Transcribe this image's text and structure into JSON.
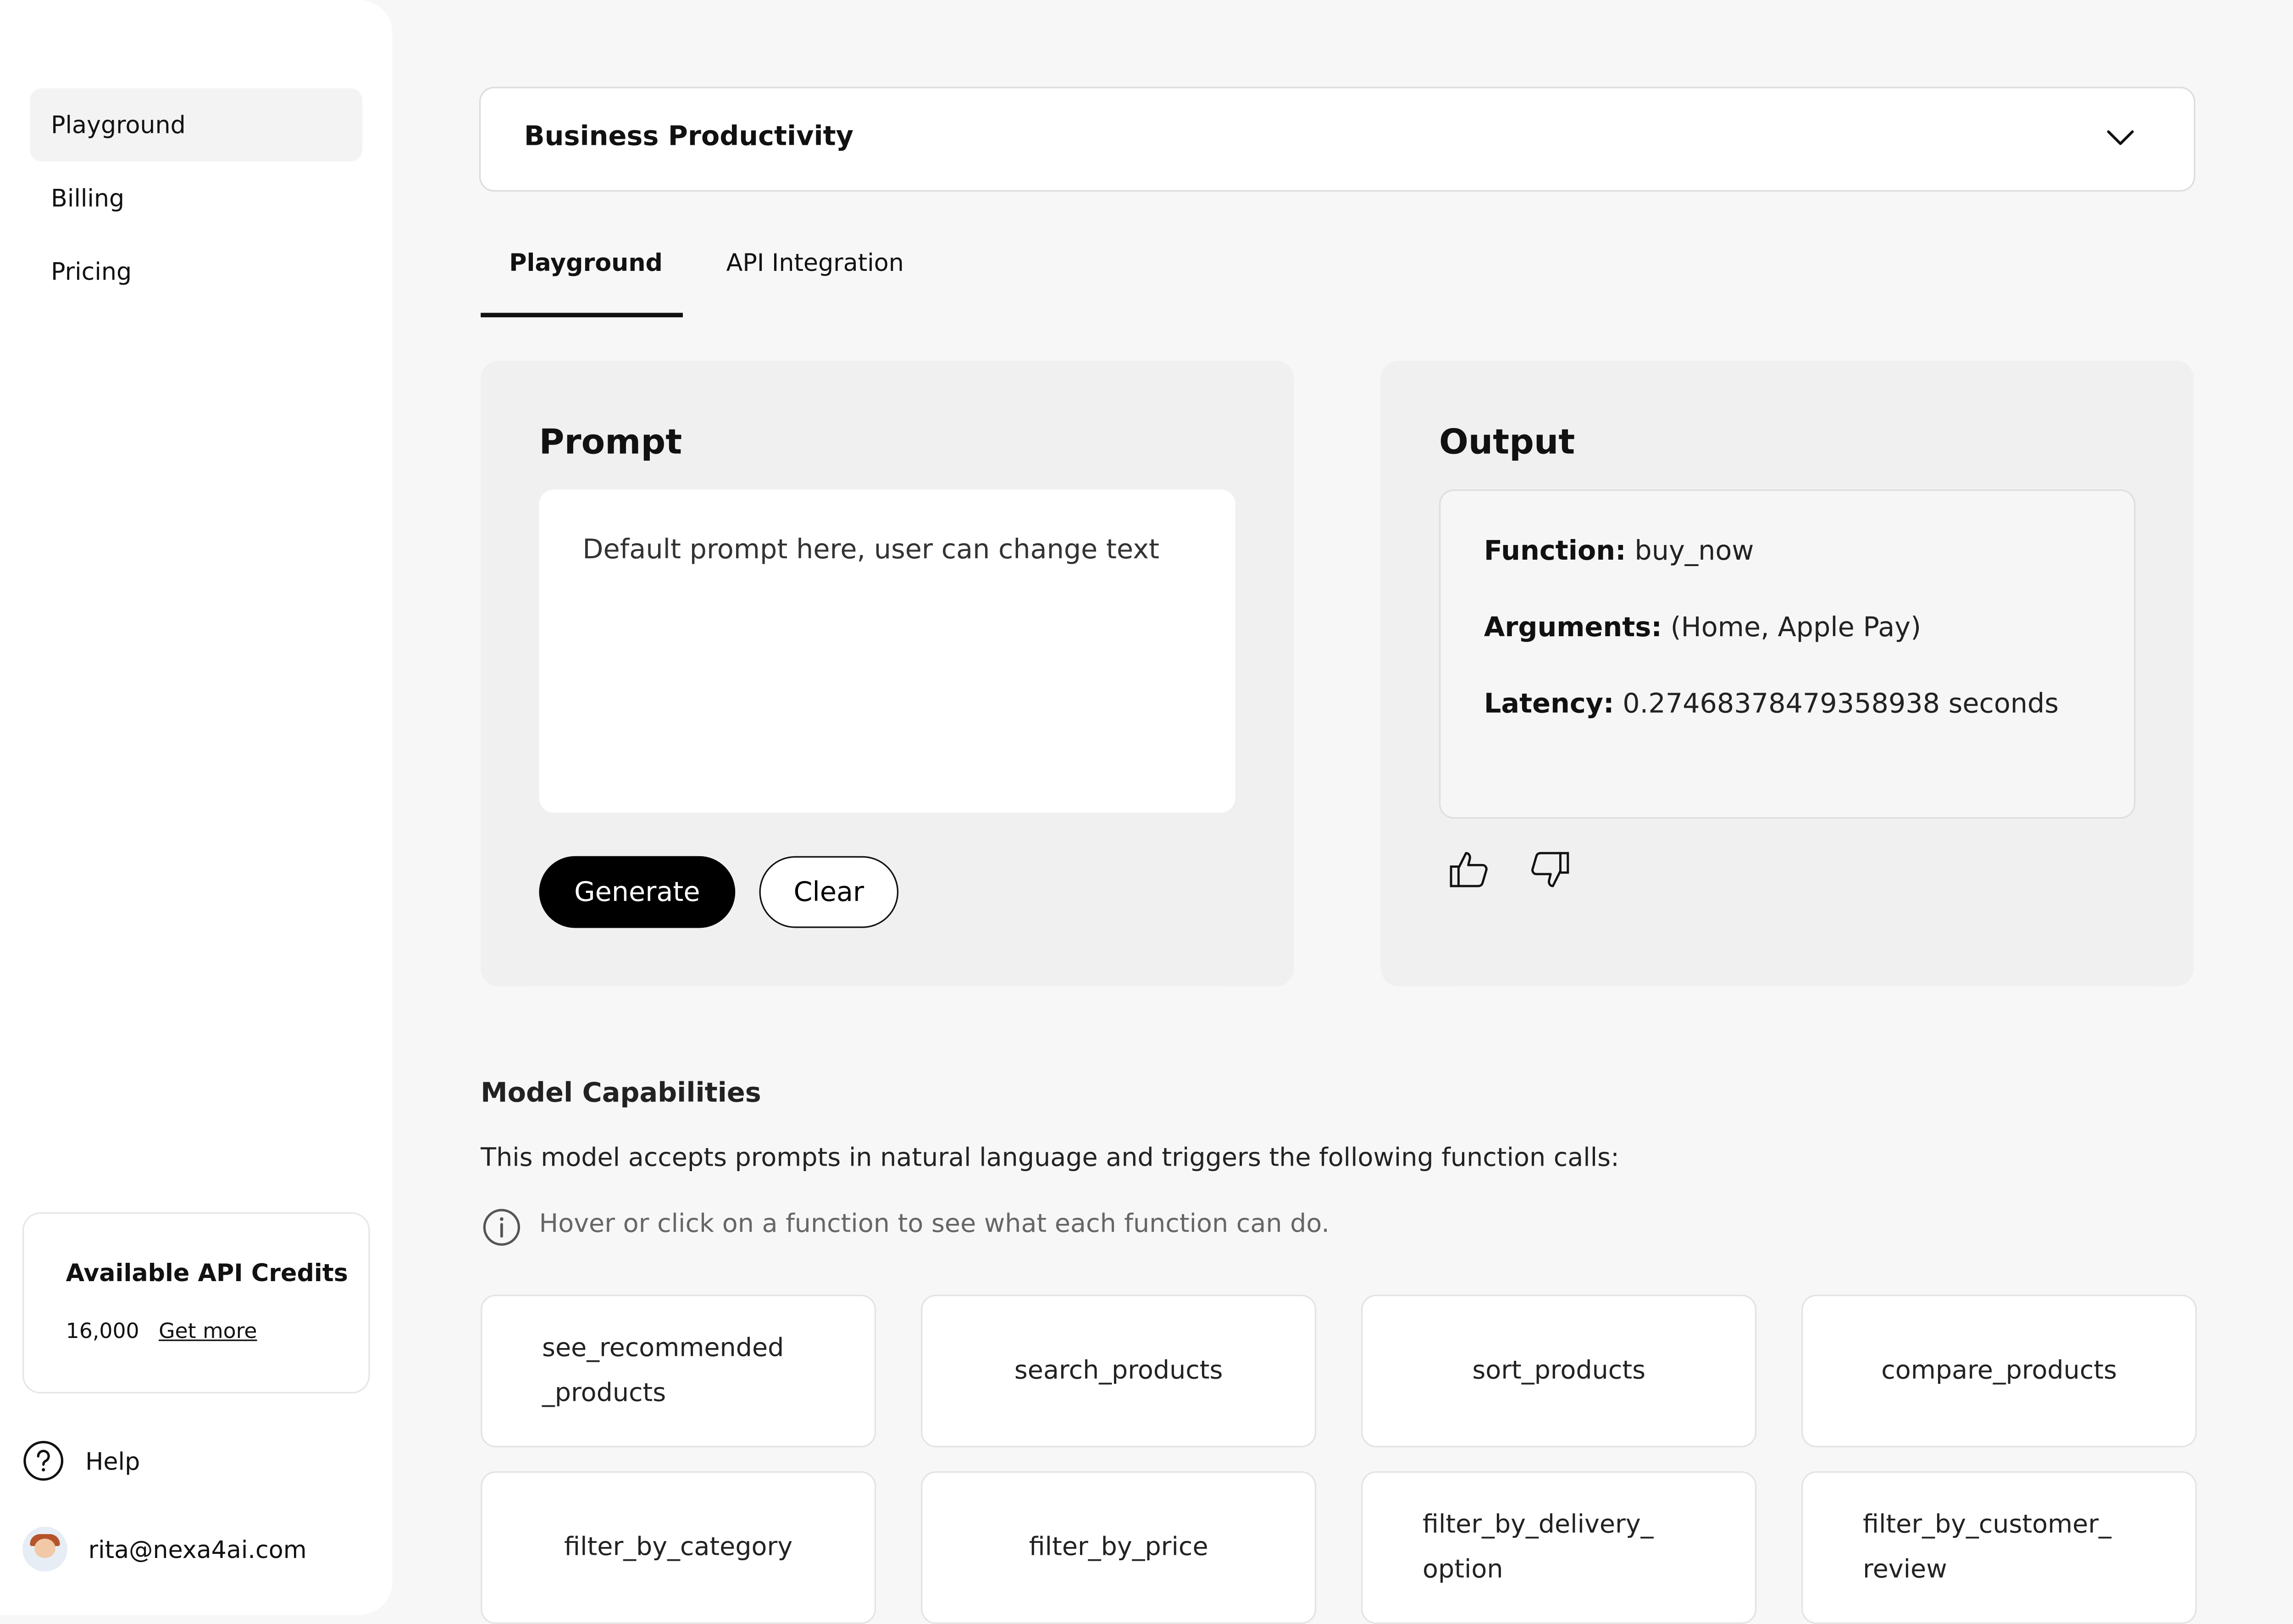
{
  "sidebar": {
    "items": [
      {
        "label": "Playground",
        "active": true
      },
      {
        "label": "Billing",
        "active": false
      },
      {
        "label": "Pricing",
        "active": false
      }
    ],
    "credits": {
      "title": "Available API Credits",
      "amount": "16,000",
      "link": "Get more"
    },
    "help": {
      "label": "Help",
      "icon": "question-circle-icon"
    },
    "user": {
      "email": "rita@nexa4ai.com"
    }
  },
  "dropdown": {
    "value": "Business Productivity",
    "icon": "chevron-down-icon"
  },
  "tabs": [
    {
      "label": "Playground",
      "active": true
    },
    {
      "label": "API Integration",
      "active": false
    }
  ],
  "prompt": {
    "title": "Prompt",
    "text": "Default prompt here, user can change text",
    "generate_label": "Generate",
    "clear_label": "Clear"
  },
  "output": {
    "title": "Output",
    "function_label": "Function:",
    "function_value": "buy_now",
    "arguments_label": "Arguments:",
    "arguments_value": "(Home, Apple Pay)",
    "latency_label": "Latency:",
    "latency_value": "0.27468378479358938 seconds"
  },
  "capabilities": {
    "title": "Model Capabilities",
    "description": "This model accepts prompts in natural language and triggers the following function calls:",
    "hint": "Hover or click on a function to see what each function can do.",
    "functions": [
      {
        "line1": "see_recommended",
        "line2": "_products"
      },
      {
        "line1": "search_products",
        "line2": ""
      },
      {
        "line1": "sort_products",
        "line2": ""
      },
      {
        "line1": "compare_products",
        "line2": ""
      },
      {
        "line1": "filter_by_category",
        "line2": ""
      },
      {
        "line1": "filter_by_price",
        "line2": ""
      },
      {
        "line1": "filter_by_delivery_",
        "line2": "option"
      },
      {
        "line1": "filter_by_customer_",
        "line2": "review"
      }
    ]
  },
  "colors": {
    "accent": "#000000",
    "background": "#f7f7f7",
    "panel": "#f0f0f0"
  }
}
